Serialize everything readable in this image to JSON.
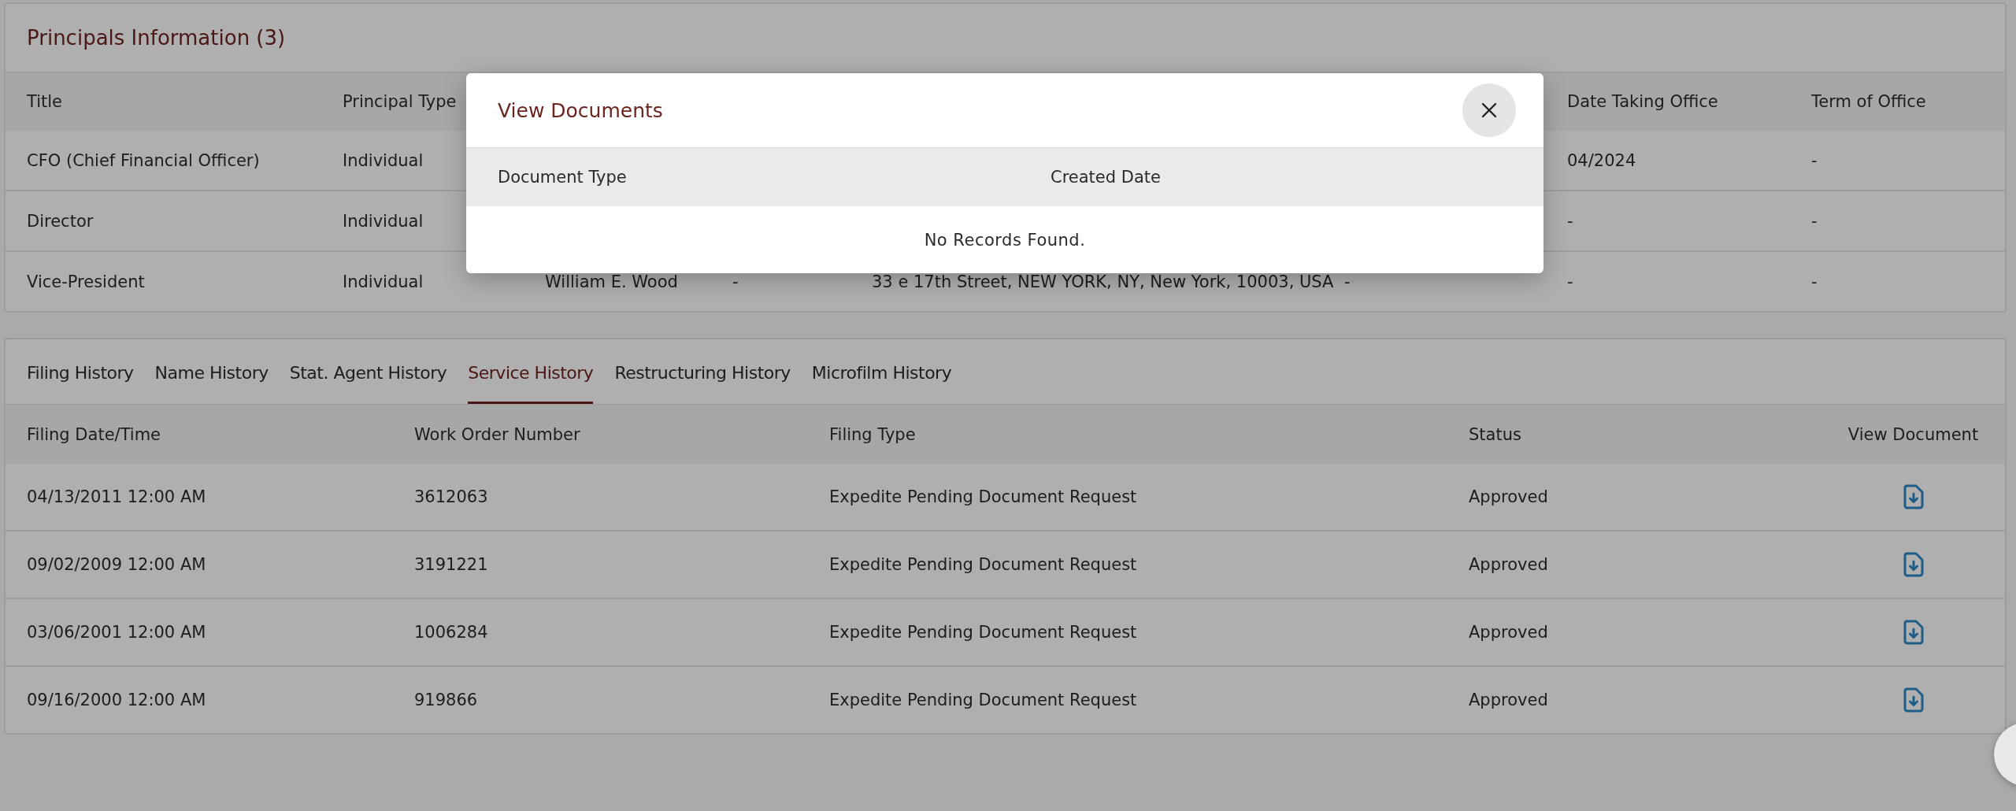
{
  "principals": {
    "title": "Principals Information (3)",
    "columns": {
      "title": "Title",
      "principal_type": "Principal Type",
      "date_taking_office": "Date Taking Office",
      "term_of_office": "Term of Office"
    },
    "rows": [
      {
        "title": "CFO (Chief Financial Officer)",
        "principal_type": "Individual",
        "date_taking_office": "04/2024",
        "term_of_office": "-"
      },
      {
        "title": "Director",
        "principal_type": "Individual",
        "date_taking_office": "-",
        "term_of_office": "-"
      },
      {
        "title": "Vice-President",
        "principal_type": "Individual",
        "column_3": "William E. Wood",
        "column_4": "-",
        "column_5": "33 e 17th Street, NEW YORK, NY, New York, 10003, USA",
        "column_6": "-",
        "date_taking_office": "-",
        "term_of_office": "-"
      }
    ]
  },
  "history": {
    "tabs": [
      {
        "label": "Filing History",
        "selected": false
      },
      {
        "label": "Name History",
        "selected": false
      },
      {
        "label": "Stat. Agent History",
        "selected": false
      },
      {
        "label": "Service History",
        "selected": true
      },
      {
        "label": "Restructuring History",
        "selected": false
      },
      {
        "label": "Microfilm History",
        "selected": false
      }
    ],
    "columns": [
      "Filing Date/Time",
      "Work Order Number",
      "Filing Type",
      "Status",
      "View Document"
    ],
    "rows": [
      {
        "date": "04/13/2011 12:00 AM",
        "work_order": "3612063",
        "filing_type": "Expedite Pending Document Request",
        "status": "Approved"
      },
      {
        "date": "09/02/2009 12:00 AM",
        "work_order": "3191221",
        "filing_type": "Expedite Pending Document Request",
        "status": "Approved"
      },
      {
        "date": "03/06/2001 12:00 AM",
        "work_order": "1006284",
        "filing_type": "Expedite Pending Document Request",
        "status": "Approved"
      },
      {
        "date": "09/16/2000 12:00 AM",
        "work_order": "919866",
        "filing_type": "Expedite Pending Document Request",
        "status": "Approved"
      }
    ]
  },
  "modal": {
    "title": "View Documents",
    "columns": [
      "Document Type",
      "Created Date"
    ],
    "empty_message": "No Records Found."
  }
}
